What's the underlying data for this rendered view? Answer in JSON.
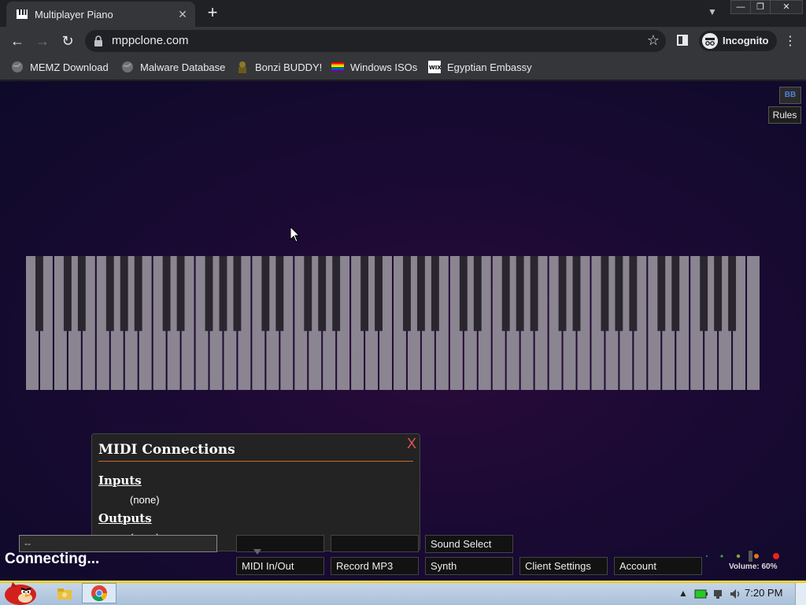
{
  "browser": {
    "tab_title": "Multiplayer Piano",
    "tab_close": "✕",
    "new_tab": "+",
    "url": "mppclone.com",
    "profile": "Incognito",
    "window_controls": {
      "minimize": "—",
      "restore": "❐",
      "close": "✕"
    }
  },
  "bookmarks": [
    {
      "label": "MEMZ Download",
      "icon": "globe-icon"
    },
    {
      "label": "Malware Database",
      "icon": "globe-icon"
    },
    {
      "label": "Bonzi BUDDY!",
      "icon": "bonzi-icon"
    },
    {
      "label": "Windows ISOs",
      "icon": "rainbow-flag-icon"
    },
    {
      "label": "Egyptian Embassy",
      "icon": "wix-icon"
    }
  ],
  "page": {
    "rules_icon_text": "BB",
    "rules_label": "Rules",
    "status": "Connecting...",
    "chat_placeholder": "--",
    "midi_panel": {
      "title": "MIDI Connections",
      "close": "X",
      "inputs_label": "Inputs",
      "inputs_value": "(none)",
      "outputs_label": "Outputs",
      "outputs_value": "(none)"
    },
    "buttons": {
      "sound_select": "Sound Select",
      "midi_in_out": "MIDI In/Out",
      "record_mp3": "Record MP3",
      "synth": "Synth",
      "client_settings": "Client Settings",
      "account": "Account"
    },
    "volume_label": "Volume: 60%",
    "volume_level": 0.6,
    "piano": {
      "white_keys": 52,
      "colors": {
        "white": "#8a8590",
        "black": "#2a2630"
      }
    }
  },
  "taskbar": {
    "clock": "7:20 PM"
  }
}
